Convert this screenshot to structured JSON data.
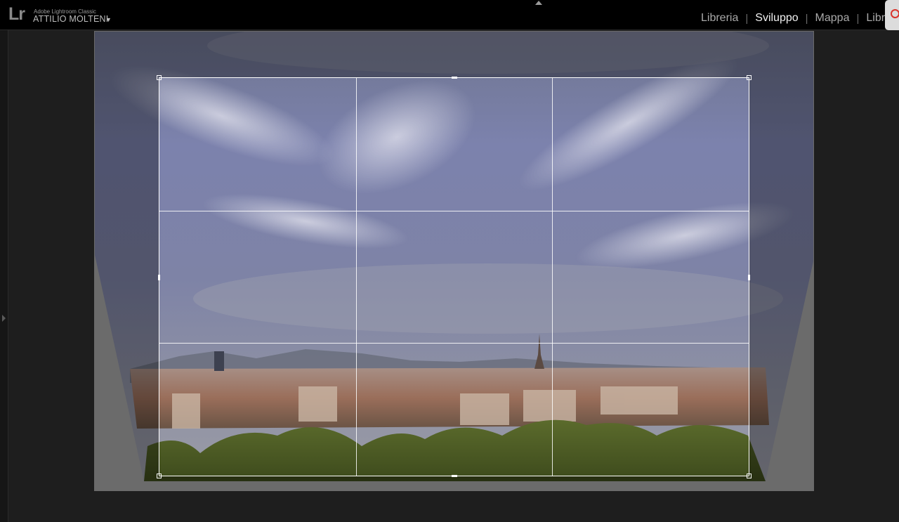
{
  "app": {
    "logo": "Lr",
    "name": "Adobe Lightroom Classic",
    "user": "ATTILIO MOLTENI",
    "user_menu_caret": "▼"
  },
  "modules": {
    "items": [
      "Libreria",
      "Sviluppo",
      "Mappa",
      "Libr"
    ],
    "separator": "|",
    "active": "Sviluppo"
  },
  "icons": {
    "collapse_top_panel": "triangle-up-icon",
    "expand_left_panel": "triangle-right-icon",
    "notification": "alarm-icon"
  },
  "crop_overlay": {
    "grid": "rule-of-thirds",
    "grid_divisions": 3
  },
  "colors": {
    "topbar_bg": "#000000",
    "workspace_bg": "#1e1e1e",
    "canvas_bg": "#a5a5a5",
    "active_module": "#f0f0f0",
    "inactive_module": "#a9a9a9",
    "crop_lines": "#ffffff"
  }
}
